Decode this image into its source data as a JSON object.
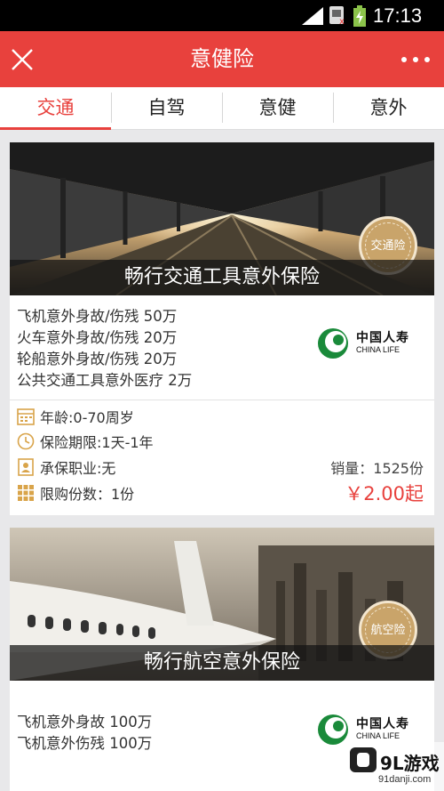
{
  "status_bar": {
    "time": "17:13"
  },
  "header": {
    "title": "意健险"
  },
  "tabs": [
    {
      "label": "交通"
    },
    {
      "label": "自驾"
    },
    {
      "label": "意健"
    },
    {
      "label": "意外"
    }
  ],
  "products": [
    {
      "banner_title": "畅行交通工具意外保险",
      "seal_label": "交通险",
      "coverage": [
        "飞机意外身故/伤残  50万",
        "火车意外身故/伤残  20万",
        "轮船意外身故/伤残  20万",
        "公共交通工具意外医疗  2万"
      ],
      "insurer": {
        "name_cn": "中国人寿",
        "name_en": "CHINA LIFE"
      },
      "details": {
        "age": "年龄:0-70周岁",
        "term": "保险期限:1天-1年",
        "occupation": "承保职业:无",
        "limit": "限购份数：1份"
      },
      "sales": "销量：1525份",
      "price": "￥2.00起"
    },
    {
      "banner_title": "畅行航空意外保险",
      "seal_label": "航空险",
      "coverage": [
        "飞机意外身故  100万",
        "飞机意外伤残  100万"
      ],
      "insurer": {
        "name_cn": "中国人寿",
        "name_en": "CHINA LIFE"
      }
    }
  ],
  "watermark": {
    "brand": "9L游戏",
    "site": "91danji.com"
  },
  "colors": {
    "accent": "#e8413d",
    "seal": "#c9a46a",
    "logo_green": "#1a8a3a"
  }
}
